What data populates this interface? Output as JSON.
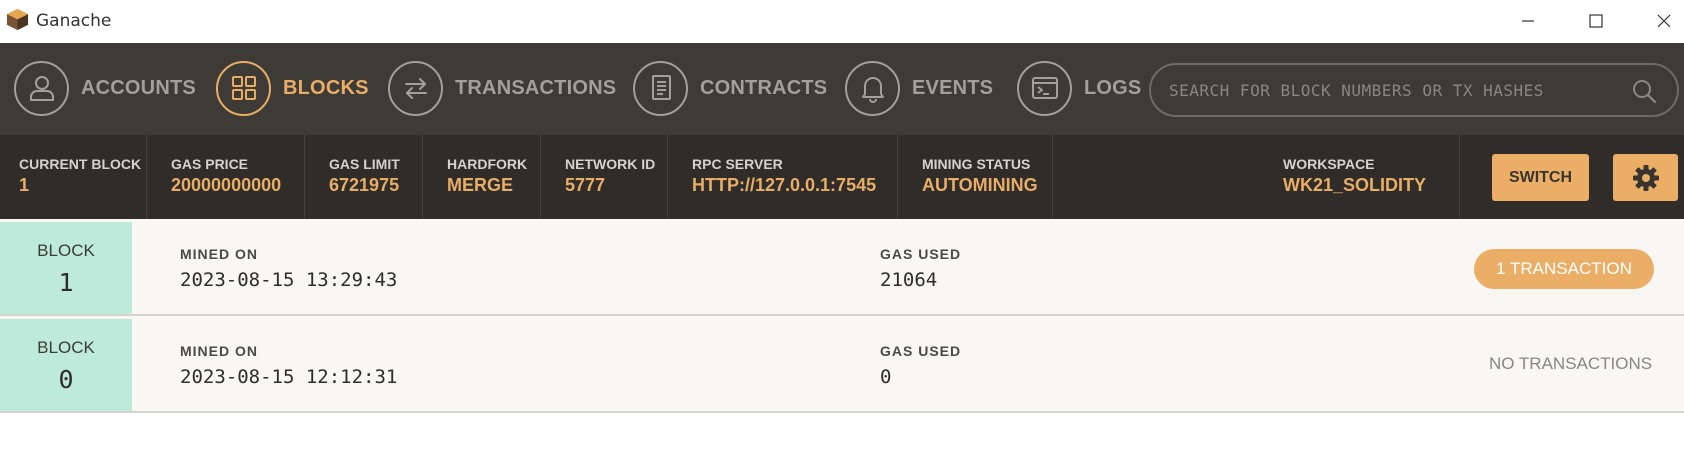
{
  "app": {
    "title": "Ganache"
  },
  "nav": {
    "items": [
      {
        "label": "ACCOUNTS",
        "icon": "user-icon",
        "active": false
      },
      {
        "label": "BLOCKS",
        "icon": "grid-icon",
        "active": true
      },
      {
        "label": "TRANSACTIONS",
        "icon": "swap-arrows-icon",
        "active": false
      },
      {
        "label": "CONTRACTS",
        "icon": "document-icon",
        "active": false
      },
      {
        "label": "EVENTS",
        "icon": "bell-icon",
        "active": false
      },
      {
        "label": "LOGS",
        "icon": "terminal-icon",
        "active": false
      }
    ],
    "search_placeholder": "SEARCH FOR BLOCK NUMBERS OR TX HASHES"
  },
  "status": {
    "current_block": {
      "label": "CURRENT BLOCK",
      "value": "1"
    },
    "gas_price": {
      "label": "GAS PRICE",
      "value": "20000000000"
    },
    "gas_limit": {
      "label": "GAS LIMIT",
      "value": "6721975"
    },
    "hardfork": {
      "label": "HARDFORK",
      "value": "MERGE"
    },
    "network_id": {
      "label": "NETWORK ID",
      "value": "5777"
    },
    "rpc_server": {
      "label": "RPC SERVER",
      "value": "HTTP://127.0.0.1:7545"
    },
    "mining_status": {
      "label": "MINING STATUS",
      "value": "AUTOMINING"
    },
    "workspace": {
      "label": "WORKSPACE",
      "value": "WK21_SOLIDITY"
    },
    "switch_label": "SWITCH"
  },
  "blocks": [
    {
      "block_label": "BLOCK",
      "number": "1",
      "mined_on_label": "MINED ON",
      "mined_on": "2023-08-15 13:29:43",
      "gas_used_label": "GAS USED",
      "gas_used": "21064",
      "transactions": "1 TRANSACTION"
    },
    {
      "block_label": "BLOCK",
      "number": "0",
      "mined_on_label": "MINED ON",
      "mined_on": "2023-08-15 12:12:31",
      "gas_used_label": "GAS USED",
      "gas_used": "0",
      "transactions": "NO TRANSACTIONS"
    }
  ],
  "colors": {
    "accent": "#e8ad66",
    "nav_bg": "#3e3a36",
    "status_bg": "#2f2c29",
    "block_cell": "#bdeadb"
  }
}
